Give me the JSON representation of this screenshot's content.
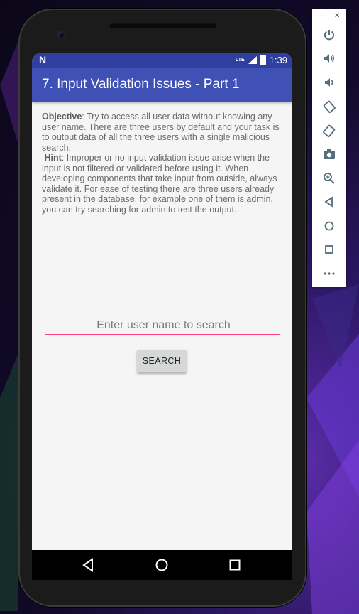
{
  "status_bar": {
    "network_label": "LTE",
    "time": "1:39"
  },
  "app_bar": {
    "title": "7. Input Validation Issues - Part 1"
  },
  "description": {
    "objective_label": "Objective",
    "objective_text": ": Try to access all user data without knowing any user name. There are three users by default and your task is to output data of all the three users with a single malicious search.",
    "hint_label": "Hint",
    "hint_text": ": Improper or no input validation issue arise when the input is not filtered or validated before using it. When developing components that take input from outside, always validate it. For ease of testing there are three users already present in the database, for example one of them is admin, you can try searching for admin to test the output."
  },
  "search": {
    "placeholder": "Enter user name to search",
    "value": "",
    "button_label": "SEARCH"
  },
  "navigation": [
    "back-icon",
    "home-icon",
    "recents-icon"
  ],
  "emulator_panel": {
    "window_controls": [
      "minimize",
      "close"
    ],
    "tools": [
      "power-icon",
      "volume-up-icon",
      "volume-down-icon",
      "rotate-left-icon",
      "rotate-right-icon",
      "camera-icon",
      "zoom-icon",
      "back-icon",
      "home-icon",
      "overview-icon",
      "more-icon"
    ]
  },
  "colors": {
    "status_bar": "#303f9f",
    "app_bar": "#3f51b5",
    "accent": "#ff4081",
    "background": "#f5f5f5"
  }
}
